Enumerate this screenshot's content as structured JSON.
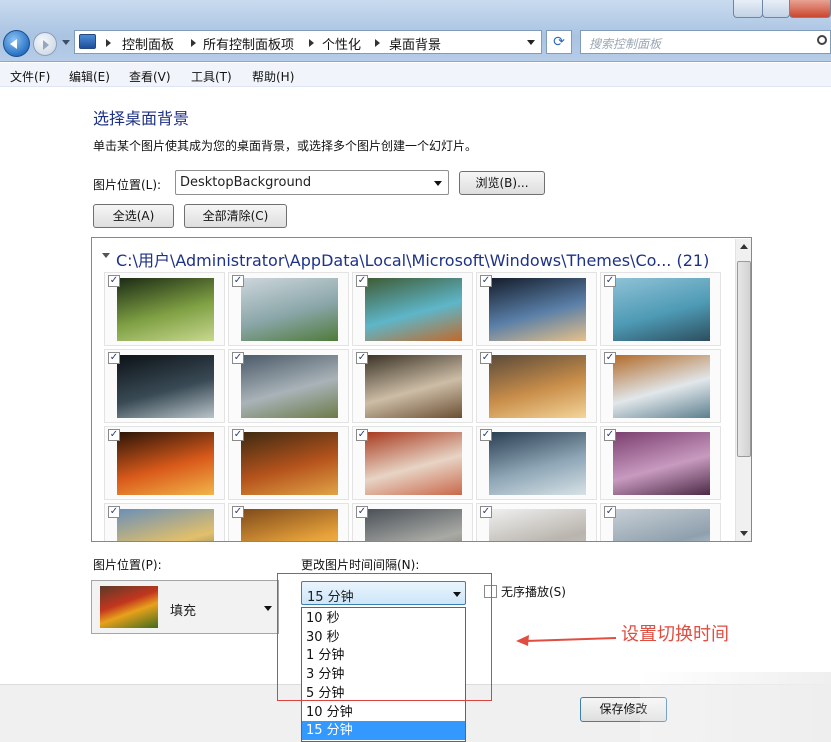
{
  "address": {
    "crumbs": [
      "控制面板",
      "所有控制面板项",
      "个性化",
      "桌面背景"
    ]
  },
  "search": {
    "placeholder": "搜索控制面板"
  },
  "menu": [
    "文件(F)",
    "编辑(E)",
    "查看(V)",
    "工具(T)",
    "帮助(H)"
  ],
  "page": {
    "title": "选择桌面背景",
    "description": "单击某个图片使其成为您的桌面背景，或选择多个图片创建一个幻灯片。",
    "location_label": "图片位置(L):",
    "location_value": "DesktopBackground",
    "browse_label": "浏览(B)...",
    "select_all_label": "全选(A)",
    "clear_all_label": "全部清除(C)"
  },
  "gallery": {
    "folder_path": "C:\\用户\\Administrator\\AppData\\Local\\Microsoft\\Windows\\Themes\\Co...",
    "count": "(21)",
    "checked_mark": "✓",
    "thumbs": [
      {
        "colors": [
          "#1b2a14",
          "#7fa043",
          "#c8d890"
        ]
      },
      {
        "colors": [
          "#cdd6dc",
          "#8aa6a8",
          "#4f7b3a"
        ]
      },
      {
        "colors": [
          "#3f5b34",
          "#5eb6c9",
          "#c06a2b"
        ]
      },
      {
        "colors": [
          "#141c2a",
          "#5a7fa8",
          "#e6c08a"
        ]
      },
      {
        "colors": [
          "#8fc2d6",
          "#4e9ab5",
          "#2c4e5e"
        ]
      },
      {
        "colors": [
          "#0c1116",
          "#394a55",
          "#b9c4c9"
        ]
      },
      {
        "colors": [
          "#4b5a69",
          "#a9b3b8",
          "#6c7b4a"
        ]
      },
      {
        "colors": [
          "#3a3226",
          "#cdbda6",
          "#6a4f34"
        ]
      },
      {
        "colors": [
          "#5a4a3a",
          "#c98e4a",
          "#f3d59a"
        ]
      },
      {
        "colors": [
          "#b26b2a",
          "#e1e7ea",
          "#5d7f8f"
        ]
      },
      {
        "colors": [
          "#2a1408",
          "#d95a1a",
          "#f2b54a"
        ]
      },
      {
        "colors": [
          "#3d2a12",
          "#b5531c",
          "#e1a447"
        ]
      },
      {
        "colors": [
          "#a83a1e",
          "#e7d4c5",
          "#c9684a"
        ]
      },
      {
        "colors": [
          "#2a3e52",
          "#8ea6b6",
          "#d8e2e6"
        ]
      },
      {
        "colors": [
          "#7a3e6e",
          "#c89ac0",
          "#4b2a45"
        ]
      },
      {
        "colors": [
          "#6a8fb8",
          "#e3c06a",
          "#3c4f66"
        ]
      },
      {
        "colors": [
          "#7e4a1a",
          "#e6a13a",
          "#f7d476"
        ]
      },
      {
        "colors": [
          "#4a5058",
          "#a9aaa5",
          "#6e5a48"
        ]
      },
      {
        "colors": [
          "#f0f0f0",
          "#b9b4ad",
          "#cfcac3"
        ]
      },
      {
        "colors": [
          "#c7cfd6",
          "#8fa0ad",
          "#e4e8eb"
        ]
      }
    ]
  },
  "position": {
    "label": "图片位置(P):",
    "value": "填充"
  },
  "interval": {
    "label": "更改图片时间间隔(N):",
    "value": "15 分钟",
    "options": [
      "10 秒",
      "30 秒",
      "1 分钟",
      "3 分钟",
      "5 分钟",
      "10 分钟",
      "15 分钟"
    ],
    "selected_index": 6
  },
  "shuffle_label": "无序播放(S)",
  "annotation": "设置切换时间",
  "save_label": "保存修改"
}
